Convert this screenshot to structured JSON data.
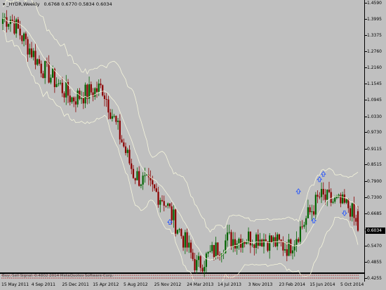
{
  "chart": {
    "symbol": "_HYDR,Weekly",
    "ohlc": "0.6768 0.6770 0.5834 0.6034",
    "last_price": "0.6034",
    "oscillator_label": "Buy, Sell Signal: 0.4802  2014 MetaQuotes Software Corp."
  },
  "colors": {
    "background": "#c0c0c0",
    "bull": "#006400",
    "bear": "#8b0000",
    "bands": "#f5f5dc",
    "signal": "#1e50ff",
    "osc_bear": "#b00000"
  },
  "chart_data": {
    "type": "candlestick",
    "title": "_HYDR,Weekly",
    "y_ticks": [
      "1.4590",
      "1.3995",
      "1.3375",
      "1.2760",
      "1.2160",
      "1.1545",
      "1.0945",
      "1.0330",
      "0.9730",
      "0.9115",
      "0.8515",
      "0.7900",
      "0.7300",
      "0.6685",
      "0.6085",
      "0.5470",
      "0.4855",
      "0.4255"
    ],
    "x_ticks": [
      "15 May 2011",
      "4 Sep 2011",
      "25 Dec 2011",
      "15 Apr 2012",
      "5 Aug 2012",
      "25 Nov 2012",
      "24 Mar 2013",
      "14 Jul 2013",
      "3 Nov 2013",
      "23 Feb 2014",
      "15 Jun 2014",
      "5 Oct 2014"
    ],
    "x": [
      "2011-05-15",
      "2011-09-04",
      "2011-12-25",
      "2012-04-15",
      "2012-08-05",
      "2012-11-25",
      "2013-03-24",
      "2013-07-14",
      "2013-11-03",
      "2014-02-23",
      "2014-06-15",
      "2014-10-05",
      "2014-11-02"
    ],
    "close": [
      1.4,
      1.22,
      1.1,
      1.14,
      0.82,
      0.72,
      0.47,
      0.57,
      0.58,
      0.54,
      0.73,
      0.69,
      0.6034
    ],
    "ylim": [
      0.4255,
      1.459
    ],
    "last_candle": {
      "open": 0.6768,
      "high": 0.677,
      "low": 0.5834,
      "close": 0.6034
    }
  }
}
